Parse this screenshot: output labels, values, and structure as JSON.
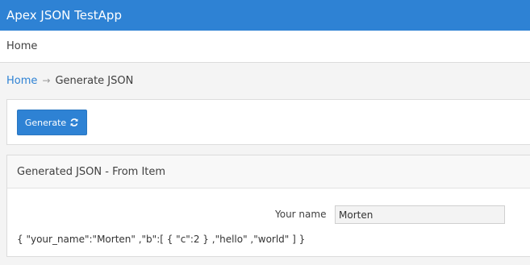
{
  "header": {
    "app_title": "Apex JSON TestApp"
  },
  "nav": {
    "items": [
      {
        "label": "Home"
      }
    ]
  },
  "breadcrumb": {
    "home_label": "Home",
    "separator": "→",
    "current_label": "Generate JSON"
  },
  "buttons_region": {
    "generate_label": "Generate",
    "generate_icon": "refresh-icon"
  },
  "json_region": {
    "title": "Generated JSON - From Item",
    "your_name_label": "Your name",
    "your_name_value": "Morten",
    "output": "{ \"your_name\":\"Morten\" ,\"b\":[ { \"c\":2 } ,\"hello\" ,\"world\" ] }"
  },
  "colors": {
    "accent": "#2e82d4",
    "background": "#f4f4f4"
  }
}
